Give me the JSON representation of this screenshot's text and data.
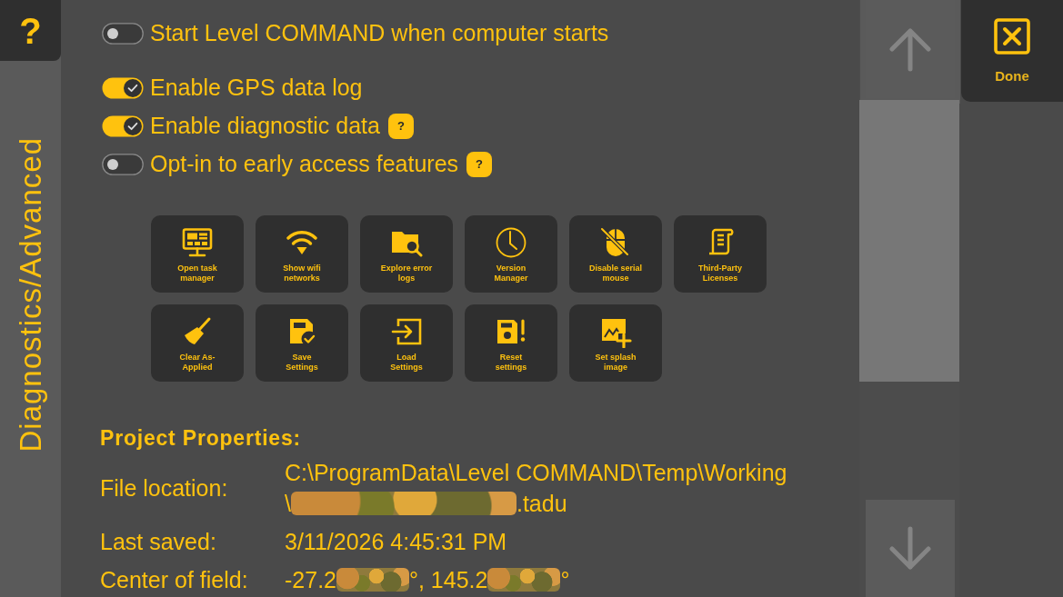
{
  "help_button": {
    "label": "?"
  },
  "section_tab": {
    "label": "Diagnostics/Advanced"
  },
  "setting_groups": [
    [
      {
        "label": "Start Level COMMAND when computer starts",
        "checked": false
      }
    ],
    [
      {
        "label": "Enable GPS data log",
        "checked": true
      },
      {
        "label": "Enable diagnostic data",
        "checked": true,
        "help": "?"
      },
      {
        "label": "Opt-in to early access features",
        "checked": false,
        "help": "?"
      }
    ]
  ],
  "tools": [
    {
      "label": "Open task\nmanager"
    },
    {
      "label": "Show wifi\nnetworks"
    },
    {
      "label": "Explore error\nlogs"
    },
    {
      "label": "Version\nManager"
    },
    {
      "label": "Disable serial\nmouse"
    },
    {
      "label": "Third-Party\nLicenses"
    },
    {
      "label": "Clear As-\nApplied"
    },
    {
      "label": "Save\nSettings"
    },
    {
      "label": "Load\nSettings"
    },
    {
      "label": "Reset\nsettings"
    },
    {
      "label": "Set splash\nimage"
    }
  ],
  "project_properties": {
    "title": "Project Properties:",
    "rows": [
      {
        "label": "File location:",
        "value_lines": [
          [
            {
              "kind": "text",
              "text": "C:\\ProgramData\\Level COMMAND\\Temp\\Working"
            }
          ],
          [
            {
              "kind": "text",
              "text": "\\"
            },
            {
              "kind": "redacted"
            },
            {
              "kind": "text",
              "text": ".tadu"
            }
          ]
        ]
      },
      {
        "label": "Last saved:",
        "value_lines": [
          [
            {
              "kind": "text",
              "text": "3/11/2026 4:45:31 PM"
            }
          ]
        ]
      },
      {
        "label": "Center of field:",
        "value_lines": [
          [
            {
              "kind": "text",
              "text": "-27.2"
            },
            {
              "kind": "redacted"
            },
            {
              "kind": "text",
              "text": "°, 145.2"
            },
            {
              "kind": "redacted"
            },
            {
              "kind": "text",
              "text": "°"
            }
          ]
        ]
      }
    ]
  },
  "done_button": {
    "label": "Done"
  }
}
